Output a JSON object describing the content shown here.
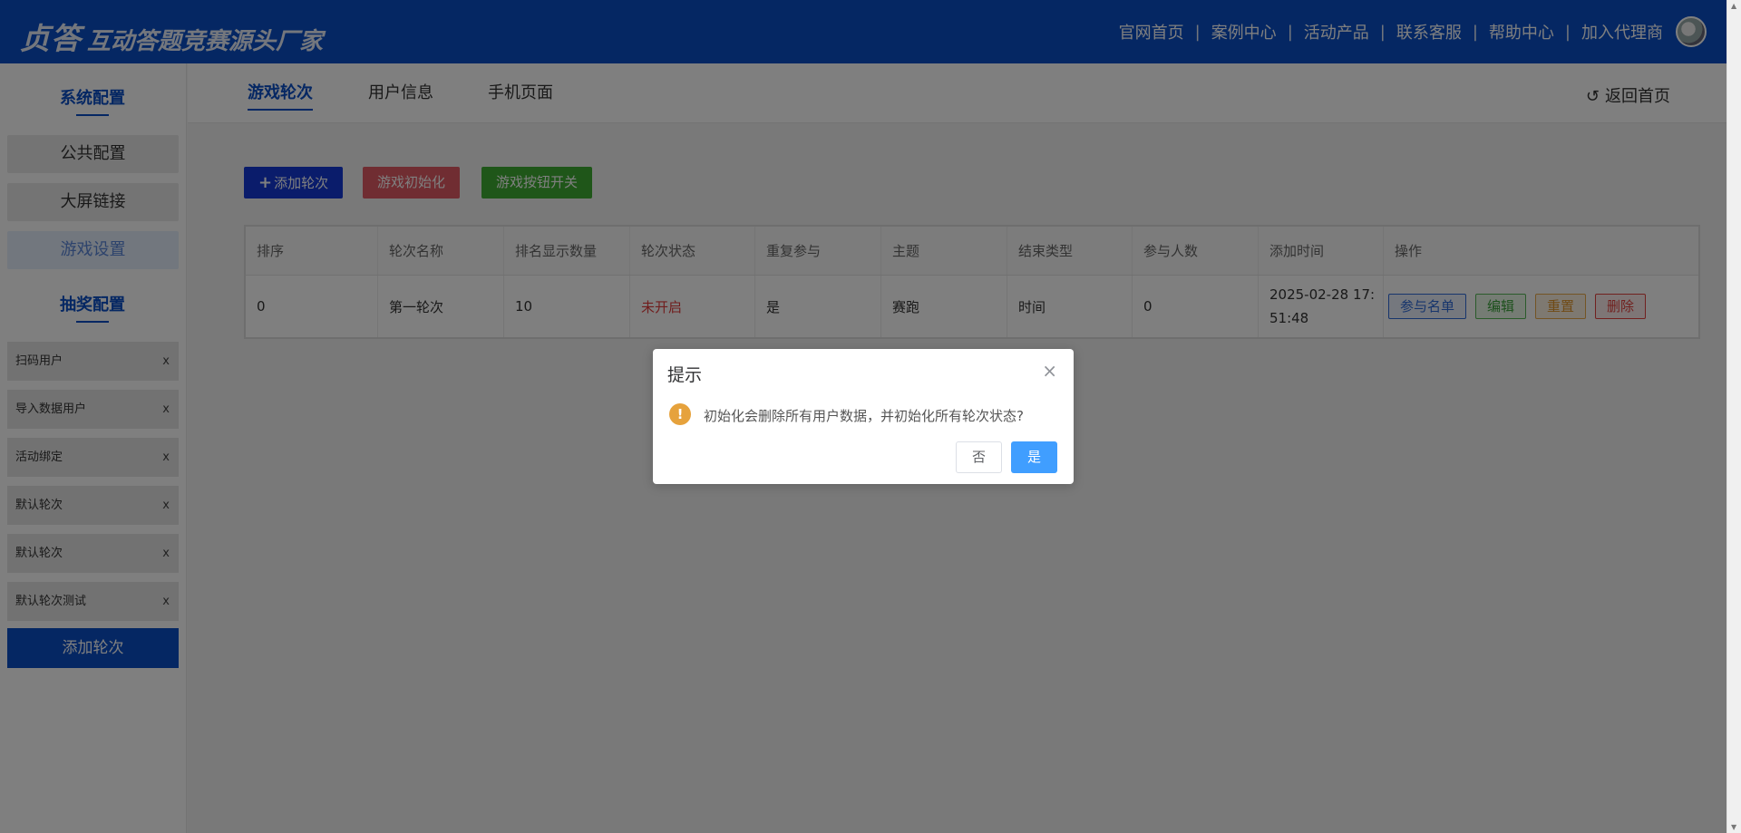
{
  "header": {
    "brand_main": "贞答",
    "brand_sub": "互动答题竞赛源头厂家",
    "nav": [
      "官网首页",
      "案例中心",
      "活动产品",
      "联系客服",
      "帮助中心",
      "加入代理商"
    ],
    "separator": "|"
  },
  "sidebar": {
    "section1_title": "系统配置",
    "menu": [
      {
        "label": "公共配置",
        "active": false
      },
      {
        "label": "大屏链接",
        "active": false
      },
      {
        "label": "游戏设置",
        "active": true
      }
    ],
    "section2_title": "抽奖配置",
    "rounds": [
      {
        "label": "扫码用户",
        "close": "x"
      },
      {
        "label": "导入数据用户",
        "close": "x"
      },
      {
        "label": "活动绑定",
        "close": "x"
      },
      {
        "label": "默认轮次",
        "close": "x"
      },
      {
        "label": "默认轮次",
        "close": "x"
      },
      {
        "label": "默认轮次测试",
        "close": "x"
      }
    ],
    "add_round": "添加轮次"
  },
  "tabs": [
    {
      "label": "游戏轮次",
      "active": true
    },
    {
      "label": "用户信息",
      "active": false
    },
    {
      "label": "手机页面",
      "active": false
    }
  ],
  "back_home": "返回首页",
  "toolbar": {
    "add": "添加轮次",
    "init": "游戏初始化",
    "toggle": "游戏按钮开关"
  },
  "table": {
    "columns": [
      "排序",
      "轮次名称",
      "排名显示数量",
      "轮次状态",
      "重复参与",
      "主题",
      "结束类型",
      "参与人数",
      "添加时间",
      "操作"
    ],
    "rows": [
      {
        "order": "0",
        "name": "第一轮次",
        "rank_count": "10",
        "status": "未开启",
        "repeat": "是",
        "theme": "赛跑",
        "end_type": "时间",
        "participants": "0",
        "added_time_line1": "2025-02-28 17:",
        "added_time_line2": "51:48",
        "actions": [
          "参与名单",
          "编辑",
          "重置",
          "删除"
        ]
      }
    ]
  },
  "dialog": {
    "title": "提示",
    "message": "初始化会删除所有用户数据，并初始化所有轮次状态?",
    "cancel": "否",
    "confirm": "是"
  },
  "colors": {
    "primary": "#0a4ec7",
    "dialog_confirm": "#409eff",
    "warning": "#e6a23c",
    "status_red": "#e03a3a"
  }
}
